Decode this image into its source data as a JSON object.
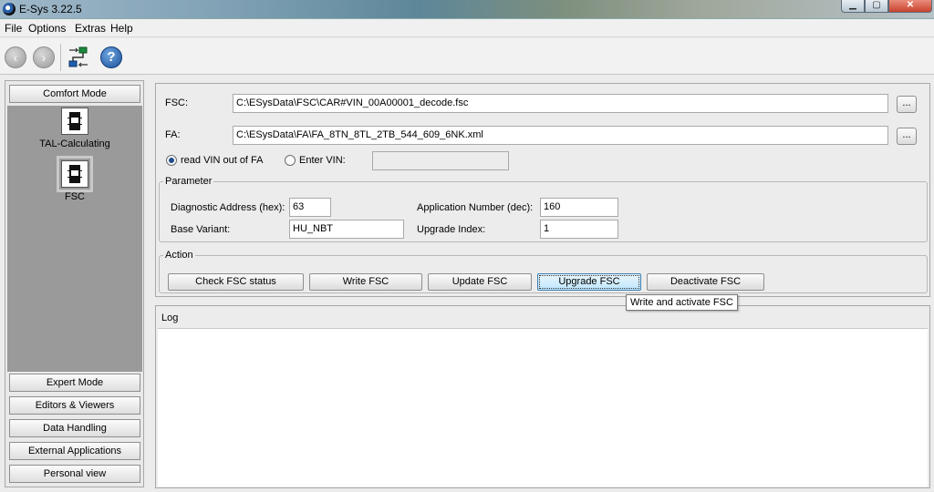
{
  "window": {
    "title": "E-Sys 3.22.5"
  },
  "menu": [
    "File",
    "Options",
    "Extras",
    "Help"
  ],
  "toolbar": {
    "icons": [
      "back-arrow-icon",
      "forward-arrow-icon",
      "connect-icon",
      "help-icon"
    ],
    "help_glyph": "?"
  },
  "sidebar": {
    "modes": [
      {
        "label": "Comfort Mode"
      },
      {
        "label": "Expert Mode"
      },
      {
        "label": "Editors & Viewers"
      },
      {
        "label": "Data Handling"
      },
      {
        "label": "External Applications"
      },
      {
        "label": "Personal view"
      }
    ],
    "tools": [
      {
        "label": "TAL-Calculating",
        "selected": false
      },
      {
        "label": "FSC",
        "selected": true
      }
    ]
  },
  "files": {
    "fsc_label": "FSC:",
    "fsc_value": "C:\\ESysData\\FSC\\CAR#VIN_00A00001_decode.fsc",
    "fa_label": "FA:",
    "fa_value": "C:\\ESysData\\FA\\FA_8TN_8TL_2TB_544_609_6NK.xml",
    "browse_label": "...",
    "vin_option_read": "read VIN out of FA",
    "vin_option_enter": "Enter VIN:",
    "vin_value": ""
  },
  "parameter": {
    "title": "Parameter",
    "diag_label": "Diagnostic Address (hex):",
    "diag_value": "63",
    "base_label": "Base Variant:",
    "base_value": "HU_NBT",
    "appnum_label": "Application Number (dec):",
    "appnum_value": "160",
    "upgrade_label": "Upgrade Index:",
    "upgrade_value": "1"
  },
  "action": {
    "title": "Action",
    "buttons": [
      {
        "label": "Check FSC status"
      },
      {
        "label": "Write FSC"
      },
      {
        "label": "Update FSC"
      },
      {
        "label": "Upgrade FSC"
      },
      {
        "label": "Deactivate FSC"
      }
    ],
    "tooltip": "Write and activate FSC"
  },
  "log": {
    "title": "Log"
  },
  "colors": {
    "selected_panel": "#9a9a9a",
    "hover_button": "#bee6fd"
  }
}
